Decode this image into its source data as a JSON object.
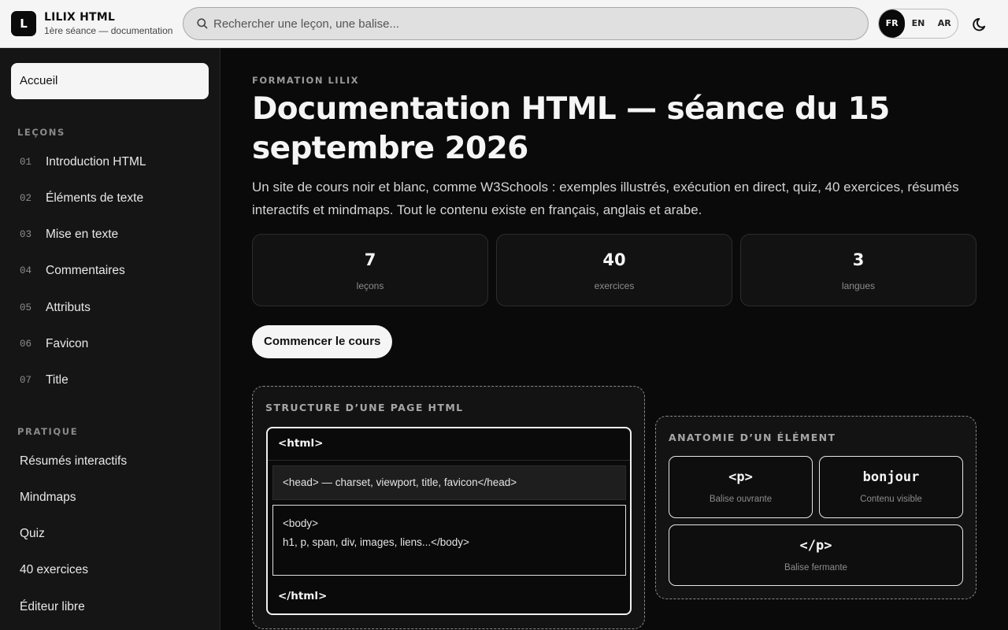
{
  "header": {
    "logo_letter": "L",
    "brand": "LILIX HTML",
    "subtitle": "1ère séance — documentation",
    "search_placeholder": "Rechercher une leçon, une balise...",
    "languages": [
      "FR",
      "EN",
      "AR"
    ],
    "active_language": "FR"
  },
  "sidebar": {
    "home": "Accueil",
    "lessons_title": "LEÇONS",
    "lessons": [
      {
        "num": "01",
        "label": "Introduction HTML"
      },
      {
        "num": "02",
        "label": "Éléments de texte"
      },
      {
        "num": "03",
        "label": "Mise en texte"
      },
      {
        "num": "04",
        "label": "Commentaires"
      },
      {
        "num": "05",
        "label": "Attributs"
      },
      {
        "num": "06",
        "label": "Favicon"
      },
      {
        "num": "07",
        "label": "Title"
      }
    ],
    "practice_title": "PRATIQUE",
    "practice": [
      "Résumés interactifs",
      "Mindmaps",
      "Quiz",
      "40 exercices",
      "Éditeur libre"
    ]
  },
  "main": {
    "eyebrow": "FORMATION LILIX",
    "title": "Documentation HTML — séance du 15 septembre 2026",
    "intro": "Un site de cours noir et blanc, comme W3Schools : exemples illustrés, exécution en direct, quiz, 40 exercices, résumés interactifs et mindmaps. Tout le contenu existe en français, anglais et arabe.",
    "stats": [
      {
        "value": "7",
        "label": "leçons"
      },
      {
        "value": "40",
        "label": "exercices"
      },
      {
        "value": "3",
        "label": "langues"
      }
    ],
    "cta": "Commencer le cours",
    "structure": {
      "title": "STRUCTURE D’UNE PAGE HTML",
      "html_open": "<html>",
      "head": "<head> — charset, viewport, title, favicon</head>",
      "body_line1": "<body>",
      "body_line2": "h1, p, span, div, images, liens...</body>",
      "html_close": "</html>"
    },
    "anatomy": {
      "title": "ANATOMIE D’UN ÉLÉMENT",
      "cards": [
        {
          "code": "<p>",
          "label": "Balise ouvrante"
        },
        {
          "code": "bonjour",
          "label": "Contenu visible"
        },
        {
          "code": "</p>",
          "label": "Balise fermante"
        }
      ]
    }
  }
}
